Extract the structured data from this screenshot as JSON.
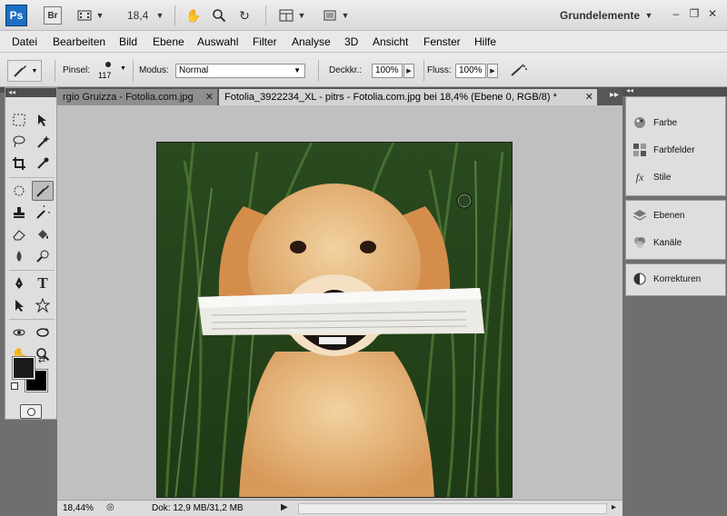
{
  "appbar": {
    "logo": "Ps",
    "bridge": "Br",
    "zoom": "18,4",
    "workspace": "Grundelemente",
    "icons": [
      "film-icon",
      "hand-icon",
      "zoom-icon",
      "rotate-view-icon",
      "arrange-documents-icon",
      "screen-mode-icon"
    ],
    "window_controls": [
      "minimize-icon",
      "restore-icon",
      "close-icon"
    ]
  },
  "menu": [
    "Datei",
    "Bearbeiten",
    "Bild",
    "Ebene",
    "Auswahl",
    "Filter",
    "Analyse",
    "3D",
    "Ansicht",
    "Fenster",
    "Hilfe"
  ],
  "options": {
    "brush_label": "Pinsel:",
    "brush_size": "117",
    "mode_label": "Modus:",
    "mode_value": "Normal",
    "opacity_label": "Deckkr.:",
    "opacity_value": "100%",
    "flow_label": "Fluss:",
    "flow_value": "100%"
  },
  "tabs": [
    {
      "label": "rgio Gruizza - Fotolia.com.jpg",
      "active": false
    },
    {
      "label": "Fotolia_3922234_XL - pitrs - Fotolia.com.jpg bei 18,4% (Ebene 0, RGB/8) *",
      "active": true
    }
  ],
  "status": {
    "zoom": "18,44%",
    "doc": "Dok: 12,9 MB/31,2 MB"
  },
  "panels": {
    "group1": [
      "Farbe",
      "Farbfelder",
      "Stile"
    ],
    "group2": [
      "Ebenen",
      "Kanäle"
    ],
    "group3": [
      "Korrekturen"
    ]
  },
  "colors": {
    "foreground": "#1a1a1a",
    "background": "#000000",
    "accent": "#1d6fc4"
  }
}
